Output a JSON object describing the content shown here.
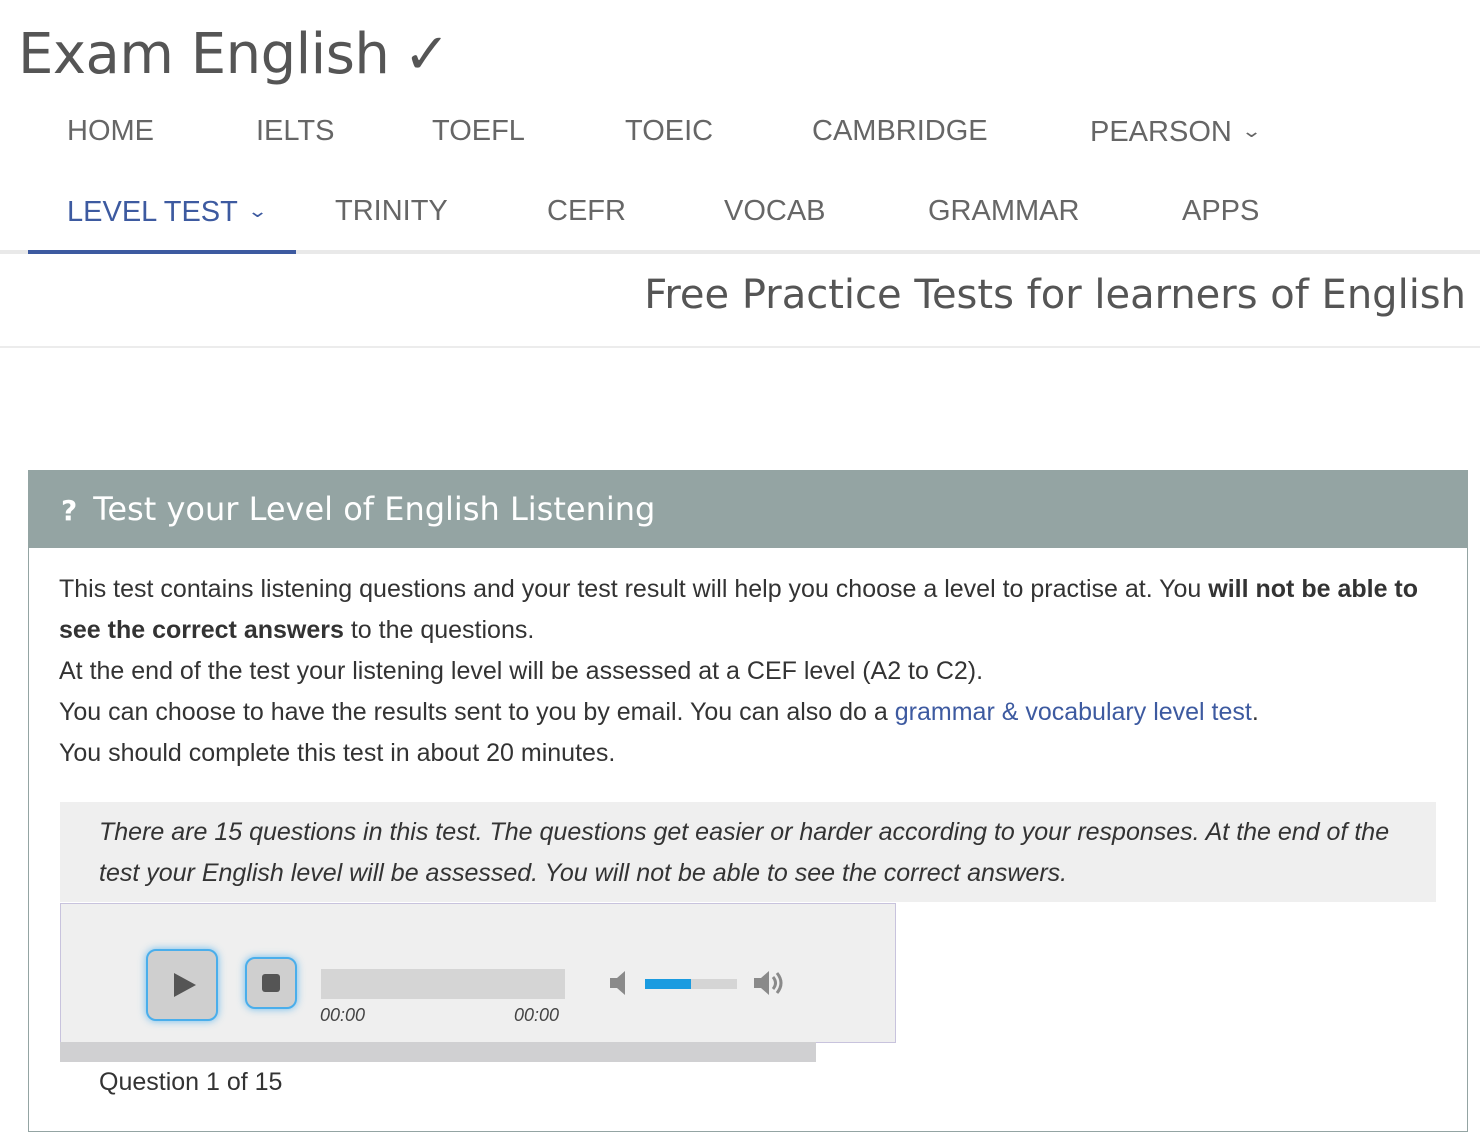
{
  "brand": {
    "name": "Exam English",
    "check": "✓"
  },
  "nav": {
    "row1": [
      {
        "label": "HOME"
      },
      {
        "label": "IELTS"
      },
      {
        "label": "TOEFL"
      },
      {
        "label": "TOEIC"
      },
      {
        "label": "CAMBRIDGE"
      },
      {
        "label": "PEARSON",
        "dropdown": true
      }
    ],
    "row2": [
      {
        "label": "LEVEL TEST",
        "dropdown": true,
        "active": true
      },
      {
        "label": "TRINITY"
      },
      {
        "label": "CEFR"
      },
      {
        "label": "VOCAB"
      },
      {
        "label": "GRAMMAR"
      },
      {
        "label": "APPS"
      }
    ],
    "chevron": "⌄"
  },
  "tagline": "Free Practice Tests for learners of English",
  "panel": {
    "icon": "?",
    "title": "Test your Level of English Listening",
    "intro": {
      "line1_a": "This test contains listening questions and your test result will help you choose a level to practise at. You ",
      "line1_bold": "will not be able to see the correct answers",
      "line1_b": " to the questions.",
      "line2": "At the end of the test your listening level will be assessed at a CEF level (A2 to C2).",
      "line3_a": "You can choose to have the results sent to you by email. You can also do a ",
      "line3_link": "grammar & vocabulary level test",
      "line3_b": ".",
      "line4": "You should complete this test in about 20 minutes."
    },
    "note": "There are 15 questions in this test. The questions get easier or harder according to your responses. At the end of the test your English level will be assessed. You will not be able to see the correct answers."
  },
  "player": {
    "current_time": "00:00",
    "duration": "00:00",
    "volume_fraction": 0.5,
    "play_icon": "play-icon",
    "stop_icon": "stop-icon"
  },
  "question_counter": "Question 1 of 15",
  "colors": {
    "accent": "#3d5aa0",
    "panel_header": "#94a4a3",
    "player_glow": "#4aaeeb",
    "volume": "#1a9be0"
  }
}
